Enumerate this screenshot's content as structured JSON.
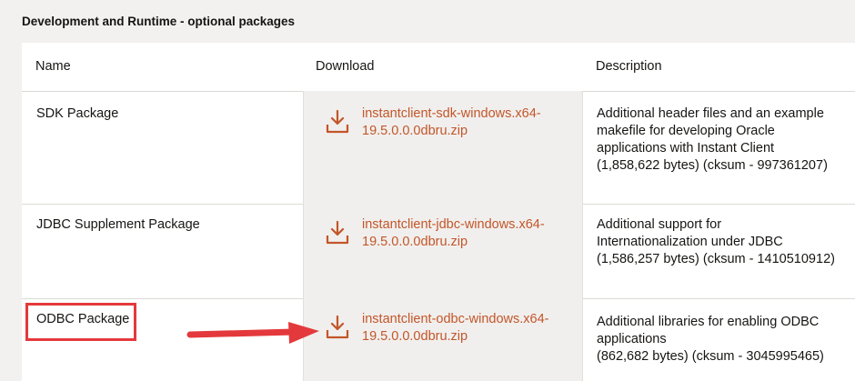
{
  "section": {
    "title": "Development and Runtime - optional packages"
  },
  "table": {
    "headers": {
      "name": "Name",
      "download": "Download",
      "description": "Description"
    },
    "rows": [
      {
        "name": "SDK Package",
        "download_line1": "instantclient-sdk-windows.x64-",
        "download_line2": "19.5.0.0.0dbru.zip",
        "description_lines": [
          "Additional header files and an example",
          "makefile for developing Oracle",
          "applications with Instant Client",
          "(1,858,622 bytes) (cksum - 997361207)"
        ]
      },
      {
        "name": "JDBC Supplement Package",
        "download_line1": "instantclient-jdbc-windows.x64-",
        "download_line2": "19.5.0.0.0dbru.zip",
        "description_lines": [
          "Additional support for",
          "Internationalization under JDBC",
          "(1,586,257 bytes) (cksum - 1410510912)"
        ]
      },
      {
        "name": "ODBC Package",
        "download_line1": "instantclient-odbc-windows.x64-",
        "download_line2": "19.5.0.0.0dbru.zip",
        "description_lines": [
          "Additional libraries for enabling ODBC",
          "applications",
          "(862,682 bytes) (cksum - 3045995465)"
        ]
      }
    ]
  },
  "icons": {
    "download": "download-icon",
    "annotation_arrow": "arrow-right-icon"
  },
  "colors": {
    "link": "#c2562a",
    "annotation": "#e4393c",
    "page_bg": "#f2f1ef",
    "shaded_cell": "#f1efed"
  }
}
